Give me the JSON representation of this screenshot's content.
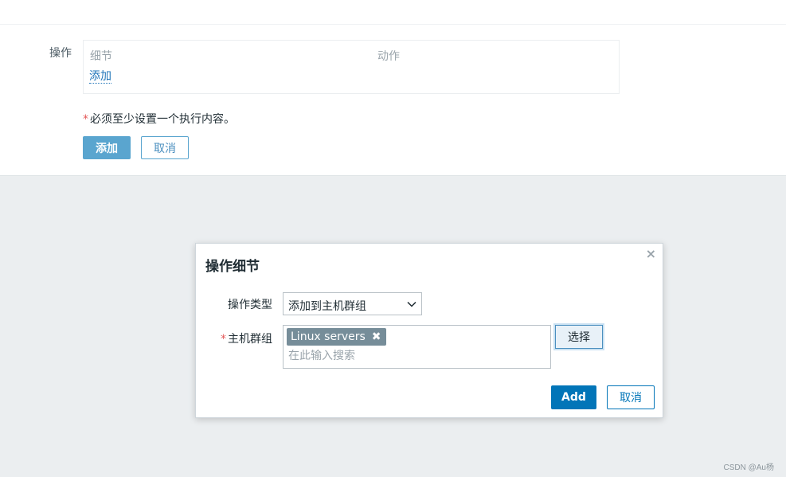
{
  "form": {
    "operations_label": "操作",
    "table_col_details": "细节",
    "table_col_action": "动作",
    "add_link": "添加",
    "required_star": "*",
    "required_note": "必须至少设置一个执行内容。",
    "add_button": "添加",
    "cancel_button": "取消"
  },
  "dialog": {
    "title": "操作细节",
    "close_glyph": "×",
    "operation_type_label": "操作类型",
    "operation_type_value": "添加到主机群组",
    "host_group_star": "*",
    "host_group_label": "主机群组",
    "selected_tags": [
      "Linux servers"
    ],
    "tag_remove_glyph": "✖",
    "search_placeholder": "在此输入搜索",
    "select_button": "选择",
    "add_button": "Add",
    "cancel_button": "取消"
  },
  "watermark": "CSDN @Au杨",
  "icons": {
    "chevron": "chevron-down-icon",
    "close": "close-icon",
    "tag_remove": "remove-tag-icon"
  },
  "colors": {
    "primary": "#0275b8",
    "primary_light": "#5aa5cf",
    "tag_bg": "#768d99",
    "required": "#e45959"
  }
}
